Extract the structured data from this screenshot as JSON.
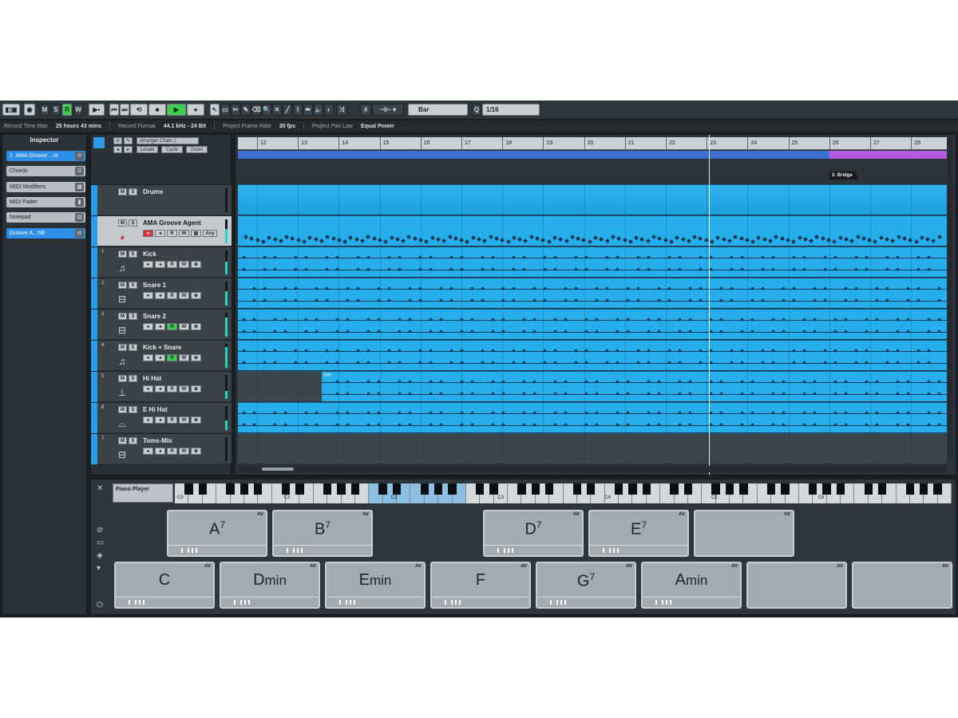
{
  "toolbar": {
    "m": "M",
    "s": "S",
    "r": "R",
    "w": "W",
    "snap_type": "Bar",
    "quantize": "1/16"
  },
  "status": {
    "record_time_label": "Record Time Max",
    "record_time_value": "25 hours 43 mins",
    "record_format_label": "Record Format",
    "record_format_value": "44.1 kHz - 24 Bit",
    "frame_rate_label": "Project Frame Rate",
    "frame_rate_value": "30 fps",
    "pan_law_label": "Project Pan Law",
    "pan_law_value": "Equal Power"
  },
  "inspector": {
    "title": "Inspector",
    "track_num": "1",
    "track_name": "AMA Groove ...nt",
    "rows": [
      "Chords",
      "MIDI Modifiers",
      "MIDI Fader",
      "Notepad"
    ],
    "groove": "Groove A...NE"
  },
  "tracklist": {
    "arranger_chain": "Arranger Chain 1",
    "locate": "Locate",
    "cycle": "Cycle",
    "zoom": "Zoom",
    "any": "Any",
    "tracks": [
      {
        "name": "Drums"
      },
      {
        "name": "AMA Groove Agent"
      },
      {
        "name": "Kick",
        "num": "1"
      },
      {
        "name": "Snare 1",
        "num": "2"
      },
      {
        "name": "Snare 2",
        "num": "3"
      },
      {
        "name": "Kick + Snare",
        "num": "4"
      },
      {
        "name": "Hi Hat",
        "num": "5"
      },
      {
        "name": "E Hi Hat",
        "num": "6"
      },
      {
        "name": "Toms-Mix",
        "num": "7"
      }
    ]
  },
  "ruler": {
    "bars": [
      "12",
      "13",
      "14",
      "15",
      "16",
      "17",
      "18",
      "19",
      "20",
      "21",
      "22",
      "23",
      "24",
      "25",
      "26",
      "27",
      "28"
    ]
  },
  "arranger": {
    "bridge_label": "3: Bridge",
    "hh_label": "HH"
  },
  "chordpads": {
    "player": "Piano Player",
    "octaves": [
      "C0",
      "C1",
      "C2",
      "C3",
      "C4",
      "C5",
      "C6"
    ],
    "av": "AV",
    "top_row": [
      {
        "root": "A",
        "ext": "7"
      },
      {
        "root": "B",
        "ext": "7"
      },
      null,
      {
        "root": "D",
        "ext": "7"
      },
      {
        "root": "E",
        "ext": "7"
      },
      {
        "root": "",
        "ext": ""
      }
    ],
    "bottom_row": [
      {
        "root": "C",
        "ext": ""
      },
      {
        "root": "D",
        "ext": "min"
      },
      {
        "root": "E",
        "ext": "min"
      },
      {
        "root": "F",
        "ext": ""
      },
      {
        "root": "G",
        "ext": "7"
      },
      {
        "root": "A",
        "ext": "min"
      },
      {
        "root": "",
        "ext": ""
      },
      {
        "root": "",
        "ext": ""
      }
    ]
  },
  "colors": {
    "accent": "#2b9be8",
    "lane": "#26adec",
    "bridge": "#b35ae0",
    "play": "#3ccf4e"
  }
}
